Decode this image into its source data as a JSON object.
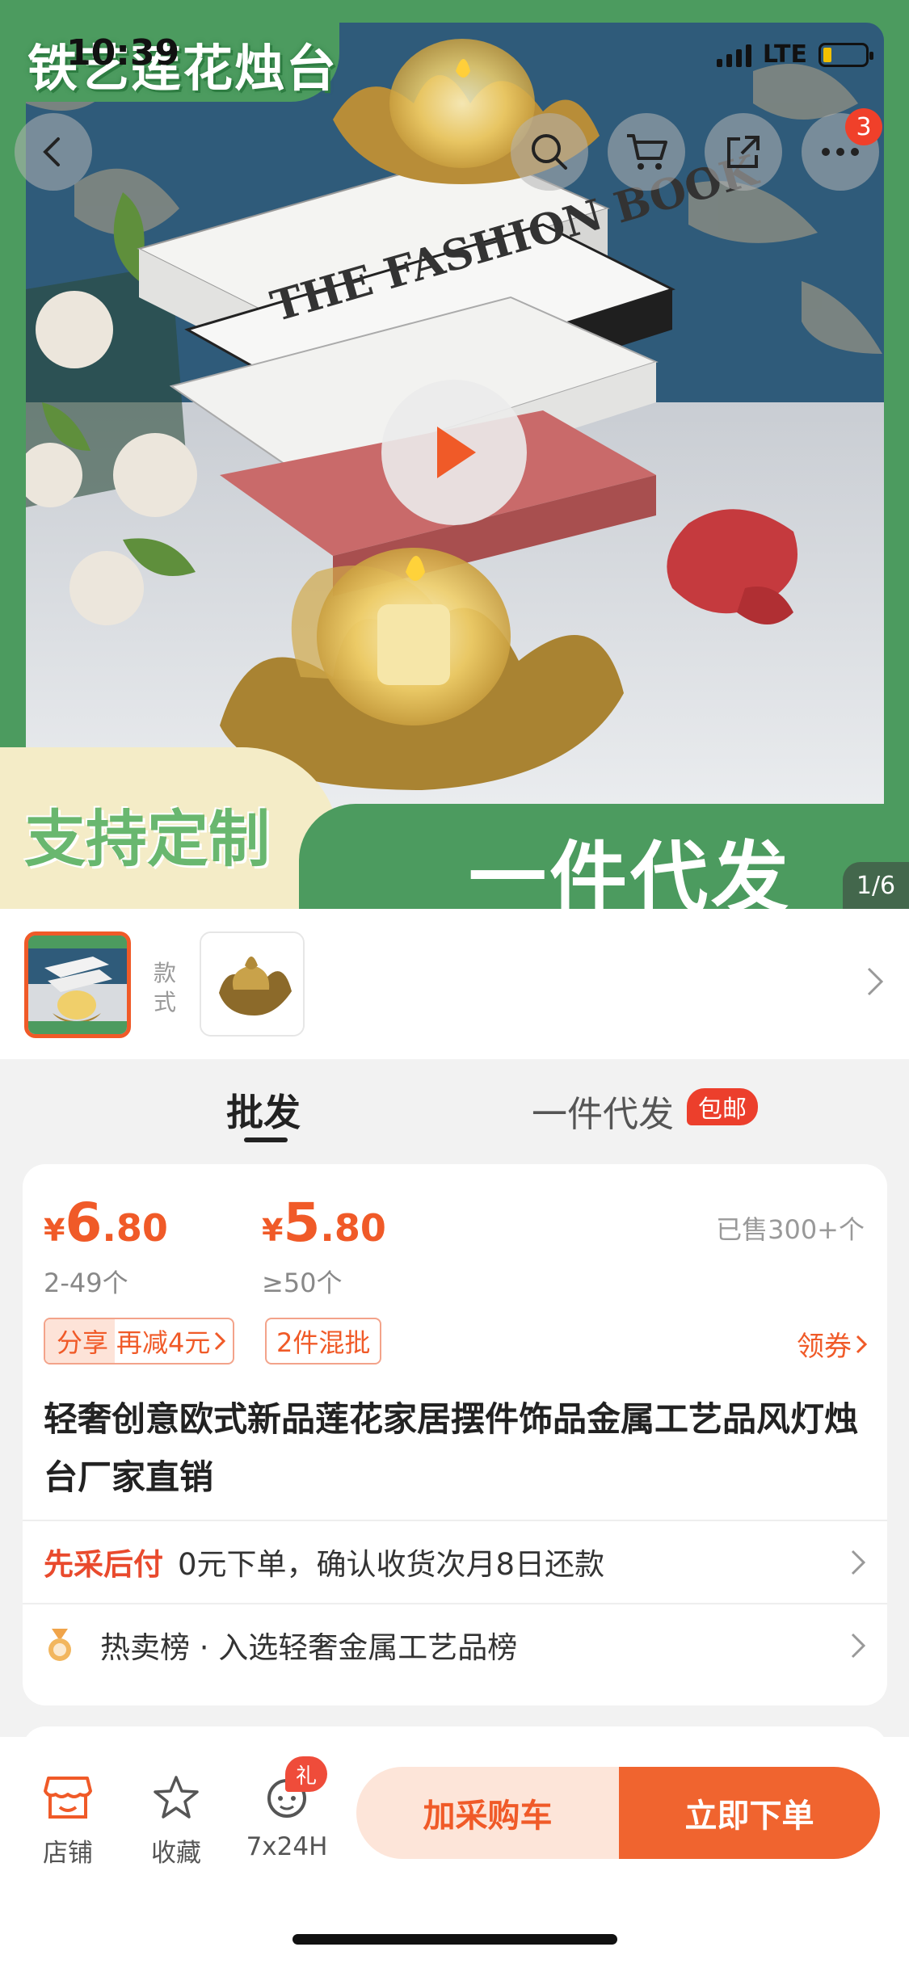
{
  "status_bar": {
    "time": "10:39",
    "network": "LTE"
  },
  "hero": {
    "title": "铁艺莲花烛台",
    "custom_tag": "支持定制",
    "dropship_tag": "一件代发",
    "counter": "1/6",
    "cart_badge": "3",
    "book_text": "THE FASHION BOOK",
    "icons": [
      "back-icon",
      "search-icon",
      "cart-icon",
      "share-icon",
      "more-icon",
      "play-icon"
    ]
  },
  "thumbs": {
    "style_label": "款式"
  },
  "tabs": {
    "wholesale": "批发",
    "dropship": "一件代发",
    "free_shipping": "包邮"
  },
  "pricing": {
    "tier1": {
      "currency": "¥",
      "integer": "6",
      "decimal": ".80",
      "range": "2-49个"
    },
    "tier2": {
      "currency": "¥",
      "integer": "5",
      "decimal": ".80",
      "range": "≥50个"
    },
    "sold": "已售300+个",
    "share_tag_part1": "分享",
    "share_tag_part2": "再减4元",
    "mix_tag": "2件混批",
    "coupon": "领券"
  },
  "product_title": "轻奢创意欧式新品莲花家居摆件饰品金属工艺品风灯烛台厂家直销",
  "pay_later": {
    "label": "先采后付",
    "text": "0元下单，确认收货次月8日还款"
  },
  "ranking": {
    "text": "热卖榜 · 入选轻奢金属工艺品榜"
  },
  "bottom_bar": {
    "shop": "店铺",
    "favorite": "收藏",
    "service": "7x24H",
    "gift_badge": "礼",
    "add_cart": "加采购车",
    "buy_now": "立即下单"
  },
  "colors": {
    "accent": "#f05a28",
    "brand_green": "#4c9b5f",
    "price": "#f05a28",
    "danger": "#ec3f2c"
  }
}
